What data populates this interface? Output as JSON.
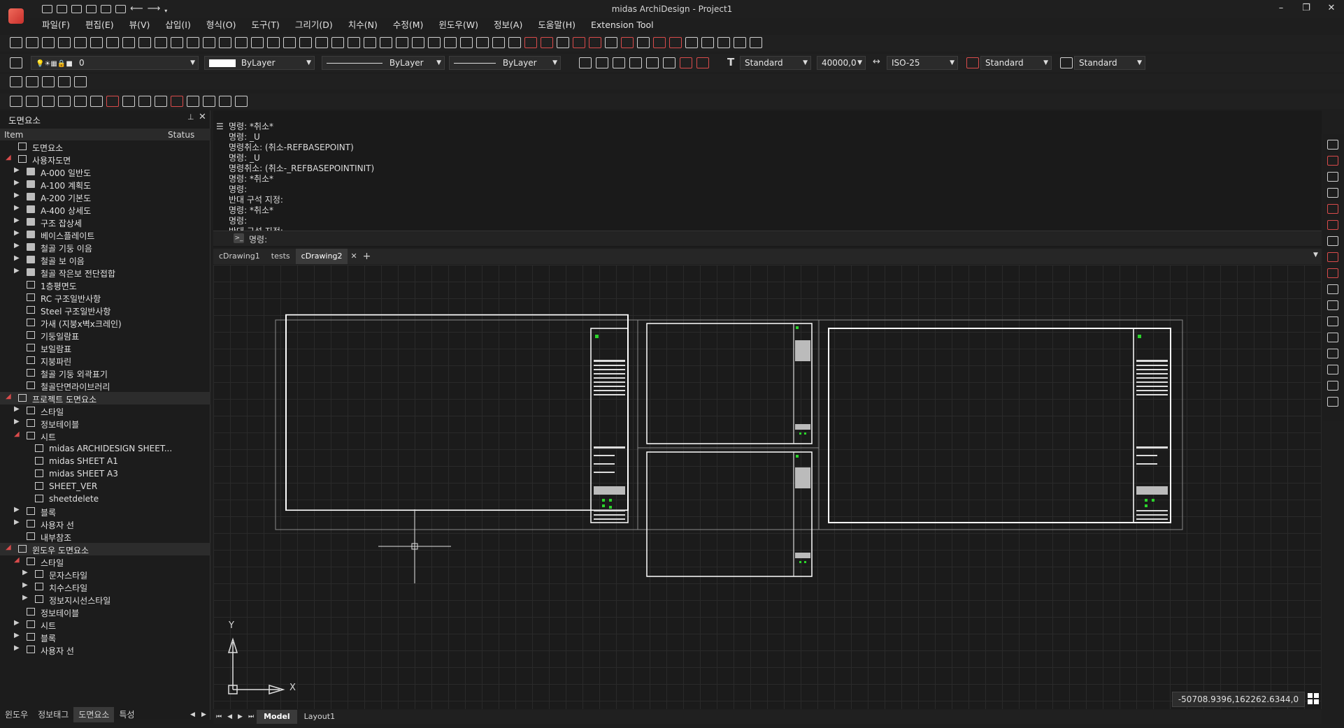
{
  "app": {
    "title": "midas ArchiDesign - Project1",
    "window_controls": [
      "–",
      "❐",
      "✕"
    ]
  },
  "menu": [
    "파일(F)",
    "편집(E)",
    "뷰(V)",
    "삽입(I)",
    "형식(O)",
    "도구(T)",
    "그리기(D)",
    "치수(N)",
    "수정(M)",
    "윈도우(W)",
    "정보(A)",
    "도움말(H)",
    "Extension Tool"
  ],
  "toolbar": {
    "layer_value": "0",
    "color_value": "ByLayer",
    "linetype_value": "ByLayer",
    "lineweight_value": "ByLayer",
    "text_style": "Standard",
    "scale_value": "40000,0",
    "dim_style": "ISO-25",
    "leader_style": "Standard",
    "table_style": "Standard"
  },
  "panel": {
    "title": "도면요소",
    "pin": "⊥",
    "close": "✕",
    "col_item": "Item",
    "col_status": "Status",
    "tree": [
      {
        "label": "도면요소",
        "level": 0,
        "tw": "",
        "icon": "box"
      },
      {
        "label": "사용자도면",
        "level": 0,
        "tw": "◢",
        "icon": "box"
      },
      {
        "label": "A-000 일반도",
        "level": 1,
        "tw": "▶",
        "icon": "folder"
      },
      {
        "label": "A-100 계획도",
        "level": 1,
        "tw": "▶",
        "icon": "folder"
      },
      {
        "label": "A-200 기본도",
        "level": 1,
        "tw": "▶",
        "icon": "folder"
      },
      {
        "label": "A-400 상세도",
        "level": 1,
        "tw": "▶",
        "icon": "folder"
      },
      {
        "label": "구조 잡상세",
        "level": 1,
        "tw": "▶",
        "icon": "folder"
      },
      {
        "label": "베이스플레이트",
        "level": 1,
        "tw": "▶",
        "icon": "folder"
      },
      {
        "label": "철골 기둥 이음",
        "level": 1,
        "tw": "▶",
        "icon": "folder"
      },
      {
        "label": "철골 보 이음",
        "level": 1,
        "tw": "▶",
        "icon": "folder"
      },
      {
        "label": "철골 작은보 전단접합",
        "level": 1,
        "tw": "▶",
        "icon": "folder"
      },
      {
        "label": "1층평면도",
        "level": 1,
        "tw": "",
        "icon": "sheet"
      },
      {
        "label": "RC 구조일반사항",
        "level": 1,
        "tw": "",
        "icon": "sheet"
      },
      {
        "label": "Steel 구조일반사항",
        "level": 1,
        "tw": "",
        "icon": "sheet"
      },
      {
        "label": "가새 (지붕x벽x크레인)",
        "level": 1,
        "tw": "",
        "icon": "sheet"
      },
      {
        "label": "기둥일람표",
        "level": 1,
        "tw": "",
        "icon": "sheet"
      },
      {
        "label": "보일람표",
        "level": 1,
        "tw": "",
        "icon": "sheet"
      },
      {
        "label": "지붕파린",
        "level": 1,
        "tw": "",
        "icon": "sheet"
      },
      {
        "label": "철골 기둥 외곽표기",
        "level": 1,
        "tw": "",
        "icon": "sheet"
      },
      {
        "label": "철골단면라이브러리",
        "level": 1,
        "tw": "",
        "icon": "sheet"
      },
      {
        "label": "프로젝트 도면요소",
        "level": 0,
        "tw": "◢",
        "icon": "box",
        "sel": true
      },
      {
        "label": "스타일",
        "level": 1,
        "tw": "▶",
        "icon": "box"
      },
      {
        "label": "정보테이블",
        "level": 1,
        "tw": "▶",
        "icon": "grid"
      },
      {
        "label": "시트",
        "level": 1,
        "tw": "◢",
        "icon": "box"
      },
      {
        "label": "midas ARCHIDESIGN SHEET...",
        "level": 2,
        "tw": "",
        "icon": "sheet"
      },
      {
        "label": "midas SHEET A1",
        "level": 2,
        "tw": "",
        "icon": "sheet"
      },
      {
        "label": "midas SHEET A3",
        "level": 2,
        "tw": "",
        "icon": "sheet"
      },
      {
        "label": "SHEET_VER",
        "level": 2,
        "tw": "",
        "icon": "sheet"
      },
      {
        "label": "sheetdelete",
        "level": 2,
        "tw": "",
        "icon": "sheet"
      },
      {
        "label": "블록",
        "level": 1,
        "tw": "▶",
        "icon": "dots"
      },
      {
        "label": "사용자 선",
        "level": 1,
        "tw": "▶",
        "icon": "lines"
      },
      {
        "label": "내부참조",
        "level": 1,
        "tw": "",
        "icon": "sheet"
      },
      {
        "label": "윈도우 도면요소",
        "level": 0,
        "tw": "◢",
        "icon": "box",
        "sel": true
      },
      {
        "label": "스타일",
        "level": 1,
        "tw": "◢",
        "icon": "box"
      },
      {
        "label": "문자스타일",
        "level": 2,
        "tw": "▶",
        "icon": "text"
      },
      {
        "label": "치수스타일",
        "level": 2,
        "tw": "▶",
        "icon": "lines"
      },
      {
        "label": "정보지시선스타일",
        "level": 2,
        "tw": "▶",
        "icon": "lines"
      },
      {
        "label": "정보테이블",
        "level": 1,
        "tw": "",
        "icon": "grid"
      },
      {
        "label": "시트",
        "level": 1,
        "tw": "▶",
        "icon": "box"
      },
      {
        "label": "블록",
        "level": 1,
        "tw": "▶",
        "icon": "dots"
      },
      {
        "label": "사용자 선",
        "level": 1,
        "tw": "▶",
        "icon": "lines"
      }
    ],
    "bottom_tabs": [
      "윈도우",
      "정보태그",
      "도면요소",
      "특성"
    ],
    "active_bottom_tab": 2
  },
  "command": {
    "history": [
      "명령: *취소*",
      "명령: _U",
      "명령취소: (취소-REFBASEPOINT)",
      "명령: _U",
      "명령취소: (취소-_REFBASEPOINTINIT)",
      "명령: *취소*",
      "명령:",
      "반대 구석 지정:",
      "명령: *취소*",
      "명령:",
      "반대 구석 지정:"
    ],
    "prompt": "명령:"
  },
  "doc_tabs": [
    "cDrawing1",
    "tests",
    "cDrawing2"
  ],
  "active_doc_tab": 2,
  "canvas": {
    "coordinates": "-50708.9396,162262.6344,0",
    "ucs_y": "Y",
    "ucs_x": "X"
  },
  "layout_tabs": [
    "Model",
    "Layout1"
  ],
  "active_layout_tab": 0,
  "colors": {
    "accent": "#d94b4b",
    "canvas": "#1b1b1b",
    "grid": "#2a2a2a",
    "green_marks": "#2bd42b"
  }
}
